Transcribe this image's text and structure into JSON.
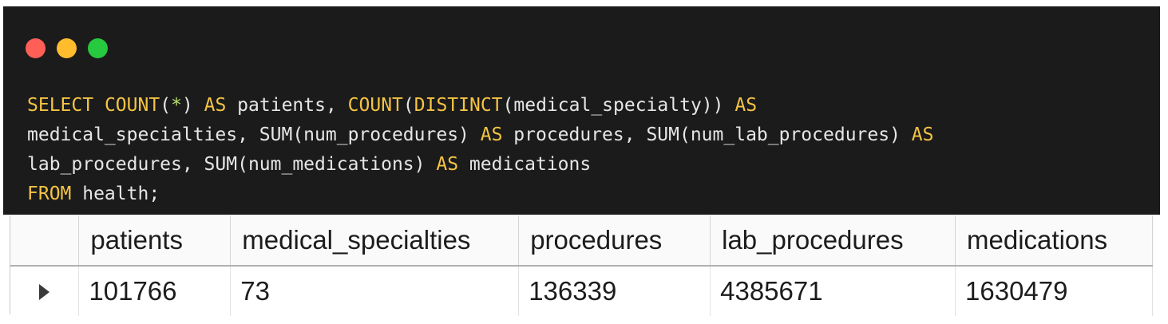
{
  "window": {
    "controls": [
      {
        "name": "close",
        "color": "#ff5f56"
      },
      {
        "name": "minimize",
        "color": "#ffbd2e"
      },
      {
        "name": "maximize",
        "color": "#27c93f"
      }
    ]
  },
  "query": {
    "kw_select": "SELECT",
    "fn_count": "COUNT",
    "paren_open": "(",
    "star": "*",
    "t1": ") ",
    "kw_as1": "AS",
    "t2": " patients, ",
    "fn_count2": "COUNT",
    "paren_open2": "(",
    "fn_distinct": "DISTINCT",
    "t3": "(medical_specialty)) ",
    "kw_as2": "AS",
    "t4": "medical_specialties, SUM(num_procedures) ",
    "kw_as3": "AS",
    "t5": " procedures, SUM(num_lab_procedures) ",
    "kw_as4": "AS",
    "t6": "lab_procedures, SUM(num_medications) ",
    "kw_as5": "AS",
    "t7": " medications",
    "kw_from": "FROM",
    "t8": " health;"
  },
  "results": {
    "columns": [
      "patients",
      "medical_specialties",
      "procedures",
      "lab_procedures",
      "medications"
    ],
    "rows": [
      [
        "101766",
        "73",
        "136339",
        "4385671",
        "1630479"
      ]
    ]
  }
}
